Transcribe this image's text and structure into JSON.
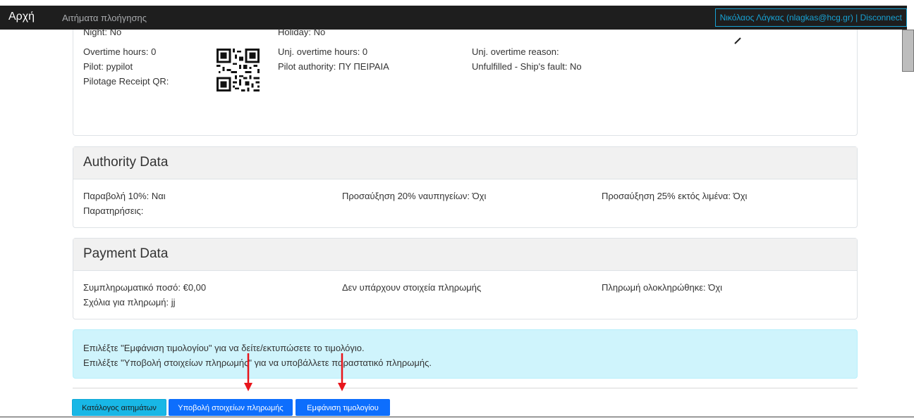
{
  "navbar": {
    "brand": "Αρχή",
    "link": "Αιτήματα πλοήγησης",
    "user": "Νικόλαος Λάγκας (nlagkas@hcg.gr) | Disconnect"
  },
  "pilotage": {
    "night": "Night: No",
    "holiday": "Holiday: No",
    "overtime_hours": "Overtime hours: 0",
    "unj_overtime_hours": "Unj. overtime hours: 0",
    "unj_overtime_reason": "Unj. overtime reason:",
    "pilot": "Pilot: pypilot",
    "pilot_authority": "Pilot authority: ΠΥ ΠΕΙΡΑΙΑ",
    "unfulfilled": "Unfulfilled - Ship's fault: No",
    "receipt_qr_label": "Pilotage Receipt QR:"
  },
  "authority": {
    "title": "Authority Data",
    "fee": "Παραβολή 10%: Ναι",
    "surcharge_shipyards": "Προσαύξηση 20% ναυπηγείων: Όχι",
    "surcharge_outside_port": "Προσαύξηση 25% εκτός λιμένα: Όχι",
    "remarks": "Παρατηρήσεις:"
  },
  "payment": {
    "title": "Payment Data",
    "additional_amount": "Συμπληρωματικό ποσό: €0,00",
    "no_payment_data": "Δεν υπάρχουν στοιχεία πληρωμής",
    "payment_completed": "Πληρωμή ολοκληρώθηκε: Όχι",
    "payment_comments": "Σχόλια για πληρωμή: jj"
  },
  "alert": {
    "line1": "Επιλέξτε \"Εμφάνιση τιμολογίου\" για να δείτε/εκτυπώσετε το τιμολόγιο.",
    "line2": "Επιλέξτε \"Υποβολή στοιχείων πληρωμής\" για να υποβάλλετε παραστατικό πληρωμής."
  },
  "buttons": {
    "requests_list": "Κατάλογος αιτημάτων",
    "submit_payment": "Υποβολή στοιχείων πληρωμής",
    "show_invoice": "Εμφάνιση τιμολογίου"
  },
  "colors": {
    "navbar_bg": "#1e1e1e",
    "accent_info": "#18b7e6",
    "primary": "#0d6efd",
    "alert_bg": "#cff4fc",
    "annotation_arrow": "#e8151b"
  }
}
